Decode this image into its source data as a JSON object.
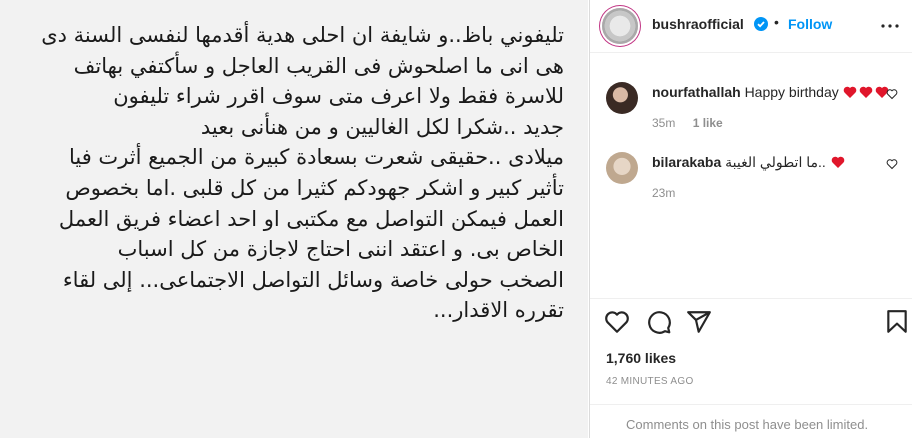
{
  "post": {
    "caption": "تليفوني باظ..و شايفة ان احلى هدية أقدمها لنفسى السنة دى\nهى انى ما اصلحوش  فى القريب العاجل و سأكتفي بهاتف\nللاسرة فقط ولا اعرف متى سوف اقرر  شراء تليفون\nجديد ..شكرا لكل  الغاليين  و من هنأنى بعيد\nميلادى ..حقيقى شعرت بسعادة كبيرة من الجميع أثرت فيا\nتأثير كبير  و اشكر جهودكم كثيرا من كل قلبى .اما بخصوص\nالعمل فيمكن التواصل مع مكتبى او احد اعضاء فريق العمل\nالخاص بى. و اعتقد اننى احتاج لاجازة من كل اسباب\nالصخب حولى خاصة وسائل التواصل الاجتماعى... إلى لقاء\nتقرره الاقدار..."
  },
  "header": {
    "username": "bushraofficial",
    "separator": "•",
    "follow_label": "Follow"
  },
  "comments": [
    {
      "username": "nourfathallah",
      "text": "Happy birthday",
      "time": "35m",
      "likes": "1 like"
    },
    {
      "username": "bilarakaba",
      "text": "ما اتطولي الغيبة..",
      "time": "23m"
    }
  ],
  "stats": {
    "likes": "1,760 likes",
    "timestamp": "42 MINUTES AGO"
  },
  "footer": {
    "limited_text": "Comments on this post have been limited."
  },
  "colors": {
    "accent": "#0095f6",
    "heart": "#ed4956",
    "muted": "#8e8e8e"
  },
  "icons": [
    "verified-badge-icon",
    "more-options-icon",
    "heart-icon",
    "comment-icon",
    "share-icon",
    "bookmark-icon"
  ]
}
